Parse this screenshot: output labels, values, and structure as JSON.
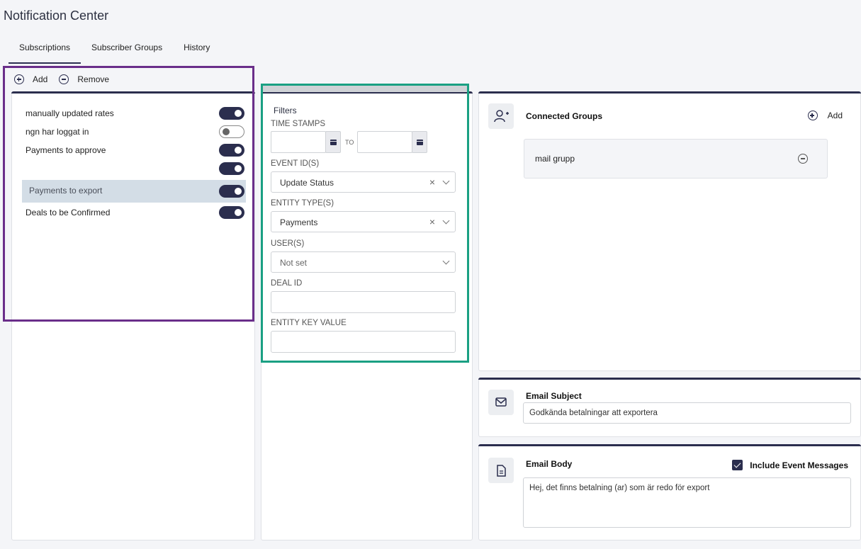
{
  "app": {
    "title": "Notification Center"
  },
  "tabs": [
    {
      "label": "Subscriptions",
      "active": true
    },
    {
      "label": "Subscriber Groups",
      "active": false
    },
    {
      "label": "History",
      "active": false
    }
  ],
  "toolbar": {
    "add_label": "Add",
    "remove_label": "Remove"
  },
  "subscriptions": [
    {
      "label": "manually updated rates",
      "enabled": true
    },
    {
      "label": "ngn har loggat in",
      "enabled": false
    },
    {
      "label": "Payments to approve",
      "enabled": true
    },
    {
      "label": "",
      "enabled": true
    },
    {
      "label": "Payments to export",
      "enabled": true,
      "selected": true
    },
    {
      "label": "Deals to be Confirmed",
      "enabled": true
    }
  ],
  "filters": {
    "title": "Filters",
    "timestamps_label": "TIME STAMPS",
    "to_label": "TO",
    "timestamp_from": "",
    "timestamp_to": "",
    "event_ids_label": "EVENT ID(S)",
    "event_ids_value": "Update Status",
    "entity_types_label": "ENTITY TYPE(S)",
    "entity_types_value": "Payments",
    "users_label": "USER(S)",
    "users_value": "Not set",
    "deal_id_label": "DEAL ID",
    "deal_id_value": "",
    "entity_key_label": "ENTITY KEY VALUE",
    "entity_key_value": ""
  },
  "connected_groups": {
    "title": "Connected Groups",
    "add_label": "Add",
    "groups": [
      {
        "name": "mail grupp"
      }
    ]
  },
  "email_subject": {
    "title": "Email Subject",
    "value": "Godkända betalningar att exportera"
  },
  "email_body": {
    "title": "Email Body",
    "include_label": "Include Event Messages",
    "include_checked": true,
    "value": "Hej, det finns betalning (ar)  som är redo för export"
  },
  "colors": {
    "accent": "#2b2e4e",
    "highlight_left": "#6a2e8a",
    "highlight_middle": "#1aa083",
    "selected_row": "#d3dde6"
  },
  "icons": {
    "add": "plus-circle-icon",
    "remove": "minus-circle-icon",
    "calendar": "calendar-icon",
    "clear": "clear-x-icon",
    "dropdown": "chevron-down-icon",
    "groups": "user-plus-icon",
    "subject": "envelope-icon",
    "body": "document-icon",
    "checkbox": "check-icon"
  }
}
